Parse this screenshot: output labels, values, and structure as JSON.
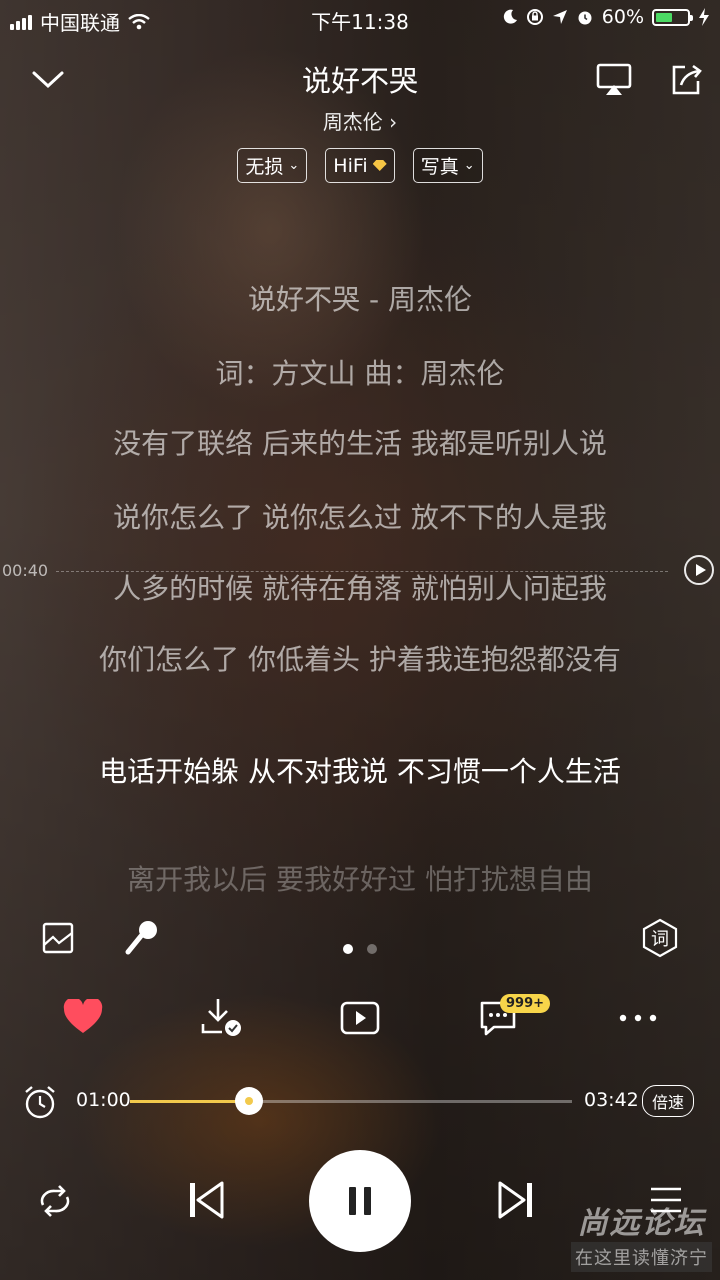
{
  "status_bar": {
    "carrier": "中国联通",
    "time": "下午11:38",
    "battery_percent": "60%",
    "battery_level": 0.6,
    "icons": [
      "signal-icon",
      "wifi-icon",
      "moon-icon",
      "rotation-lock-icon",
      "location-icon",
      "alarm-icon",
      "battery-icon",
      "charging-icon"
    ]
  },
  "header": {
    "title": "说好不哭",
    "artist": "周杰伦 ›",
    "tags": [
      {
        "label": "无损",
        "icon": "chevron-down-icon"
      },
      {
        "label": "HiFi",
        "icon": "diamond-icon"
      },
      {
        "label": "写真",
        "icon": "chevron-down-icon"
      }
    ]
  },
  "lyrics": {
    "lines": [
      "说好不哭 - 周杰伦",
      "词：方文山  曲：周杰伦",
      "没有了联络  后来的生活  我都是听别人说",
      "说你怎么了  说你怎么过  放不下的人是我",
      "人多的时候  就待在角落  就怕别人问起我",
      "你们怎么了  你低着头  护着我连抱怨都没有",
      "电话开始躲  从不对我说  不习惯一个人生活",
      "离开我以后  要我好好过  怕打扰想自由"
    ],
    "active_index": 6,
    "seek_time": "00:40"
  },
  "pager": {
    "pages": 2,
    "current": 0
  },
  "actions": {
    "comment_badge": "999+",
    "lyric_button": "词"
  },
  "progress": {
    "current": "01:00",
    "total": "03:42",
    "fraction": 0.27,
    "speed_label": "倍速"
  },
  "colors": {
    "accent": "#f2c94c",
    "heart": "#ff4d5e",
    "battery": "#4cd964"
  },
  "watermark": {
    "line1": "尚远论坛",
    "line2": "在这里读懂济宁"
  }
}
